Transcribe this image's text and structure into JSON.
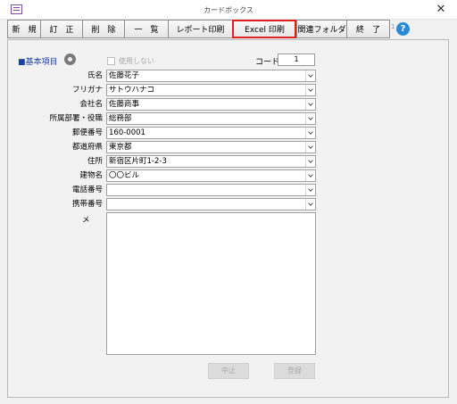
{
  "window": {
    "title": "カードボックス",
    "close_glyph": "✕",
    "app_icon": "card-box-app-icon"
  },
  "toolbar": {
    "buttons": [
      {
        "label": "新　規"
      },
      {
        "label": "訂　正"
      },
      {
        "label": "削　除"
      },
      {
        "label": "一　覧"
      },
      {
        "label": "レポート印刷"
      },
      {
        "label": "Excel 印刷",
        "highlighted": true
      },
      {
        "label": "関連フォルダ"
      },
      {
        "label": "終　了"
      }
    ],
    "help_number": "1",
    "help_glyph": "?"
  },
  "section": {
    "title": "■基本項目",
    "unused_label": "使用しない",
    "unused_checked": false,
    "code_label": "コード",
    "code_value": "1"
  },
  "fields": [
    {
      "label": "氏名",
      "value": "佐藤花子"
    },
    {
      "label": "フリガナ",
      "value": "サトウハナコ"
    },
    {
      "label": "会社名",
      "value": "佐藤商事"
    },
    {
      "label": "所属部署・役職",
      "value": "総務部"
    },
    {
      "label": "郵便番号",
      "value": "160-0001"
    },
    {
      "label": "都道府県",
      "value": "東京都"
    },
    {
      "label": "住所",
      "value": "新宿区片町1-2-3"
    },
    {
      "label": "建物名",
      "value": "〇〇ビル"
    },
    {
      "label": "電話番号",
      "value": ""
    },
    {
      "label": "携帯番号",
      "value": ""
    }
  ],
  "memo": {
    "label": "メ　モ",
    "value": ""
  },
  "actions": {
    "cancel_label": "中止",
    "register_label": "登録"
  },
  "colors": {
    "highlight_border": "#e02020",
    "section_title": "#1f3fa8",
    "help_icon": "#2b8ad8"
  }
}
